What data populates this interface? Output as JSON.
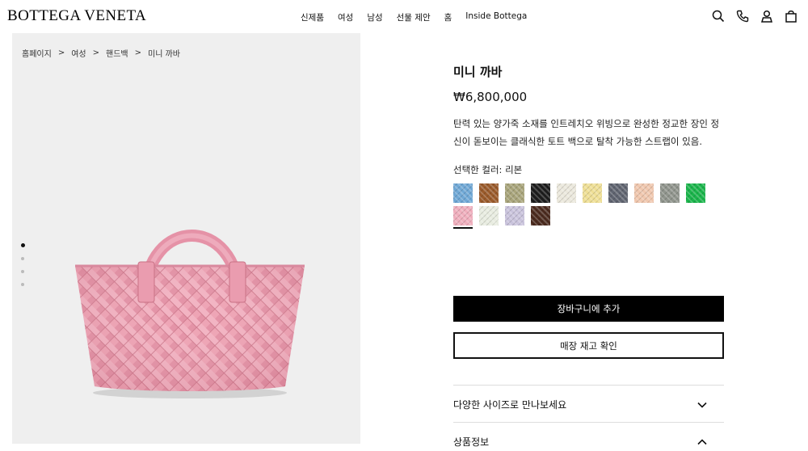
{
  "brand": {
    "logo": "BOTTEGA VENETA"
  },
  "nav": {
    "items": [
      "신제품",
      "여성",
      "남성",
      "선물 제안",
      "홈",
      "Inside Bottega"
    ]
  },
  "header_icons": [
    "search-icon",
    "phone-icon",
    "account-icon",
    "shopping-bag-icon"
  ],
  "breadcrumb": [
    "홈페이지",
    "여성",
    "핸드백",
    "미니 까바"
  ],
  "breadcrumb_separator": ">",
  "gallery": {
    "image_count": 4,
    "active_index": 0,
    "bag_color": "#eea3b4"
  },
  "product": {
    "name": "미니 까바",
    "price": "₩6,800,000",
    "description": "탄력 있는 양가죽 소재를 인트레치오 위빙으로 완성한 정교한 장인 정신이 돋보이는 클래식한 토트 백으로 탈착 가능한 스트랩이 있음.",
    "selected_color_label": "선택한 컬러: 리본"
  },
  "swatches": [
    {
      "color": "#6fa8d6",
      "selected": false
    },
    {
      "color": "#9a5a2a",
      "selected": false
    },
    {
      "color": "#a8a47a",
      "selected": false
    },
    {
      "color": "#1c1c1c",
      "selected": false
    },
    {
      "color": "#ebe8dc",
      "selected": false
    },
    {
      "color": "#efdf95",
      "selected": false
    },
    {
      "color": "#5f6470",
      "selected": false
    },
    {
      "color": "#f0c7ae",
      "selected": false
    },
    {
      "color": "#8f948c",
      "selected": false
    },
    {
      "color": "#19b54a",
      "selected": false
    },
    {
      "color": "#f0aebd",
      "selected": true
    },
    {
      "color": "#e8ece0",
      "selected": false
    },
    {
      "color": "#c9c3dc",
      "selected": false
    },
    {
      "color": "#4a2a1e",
      "selected": false
    }
  ],
  "actions": {
    "add_to_cart": "장바구니에 추가",
    "check_store_stock": "매장 재고 확인"
  },
  "accordions": [
    {
      "label": "다양한 사이즈로 만나보세요",
      "icon": "chevron-down-icon"
    },
    {
      "label": "상품정보",
      "icon": "chevron-up-icon"
    }
  ]
}
